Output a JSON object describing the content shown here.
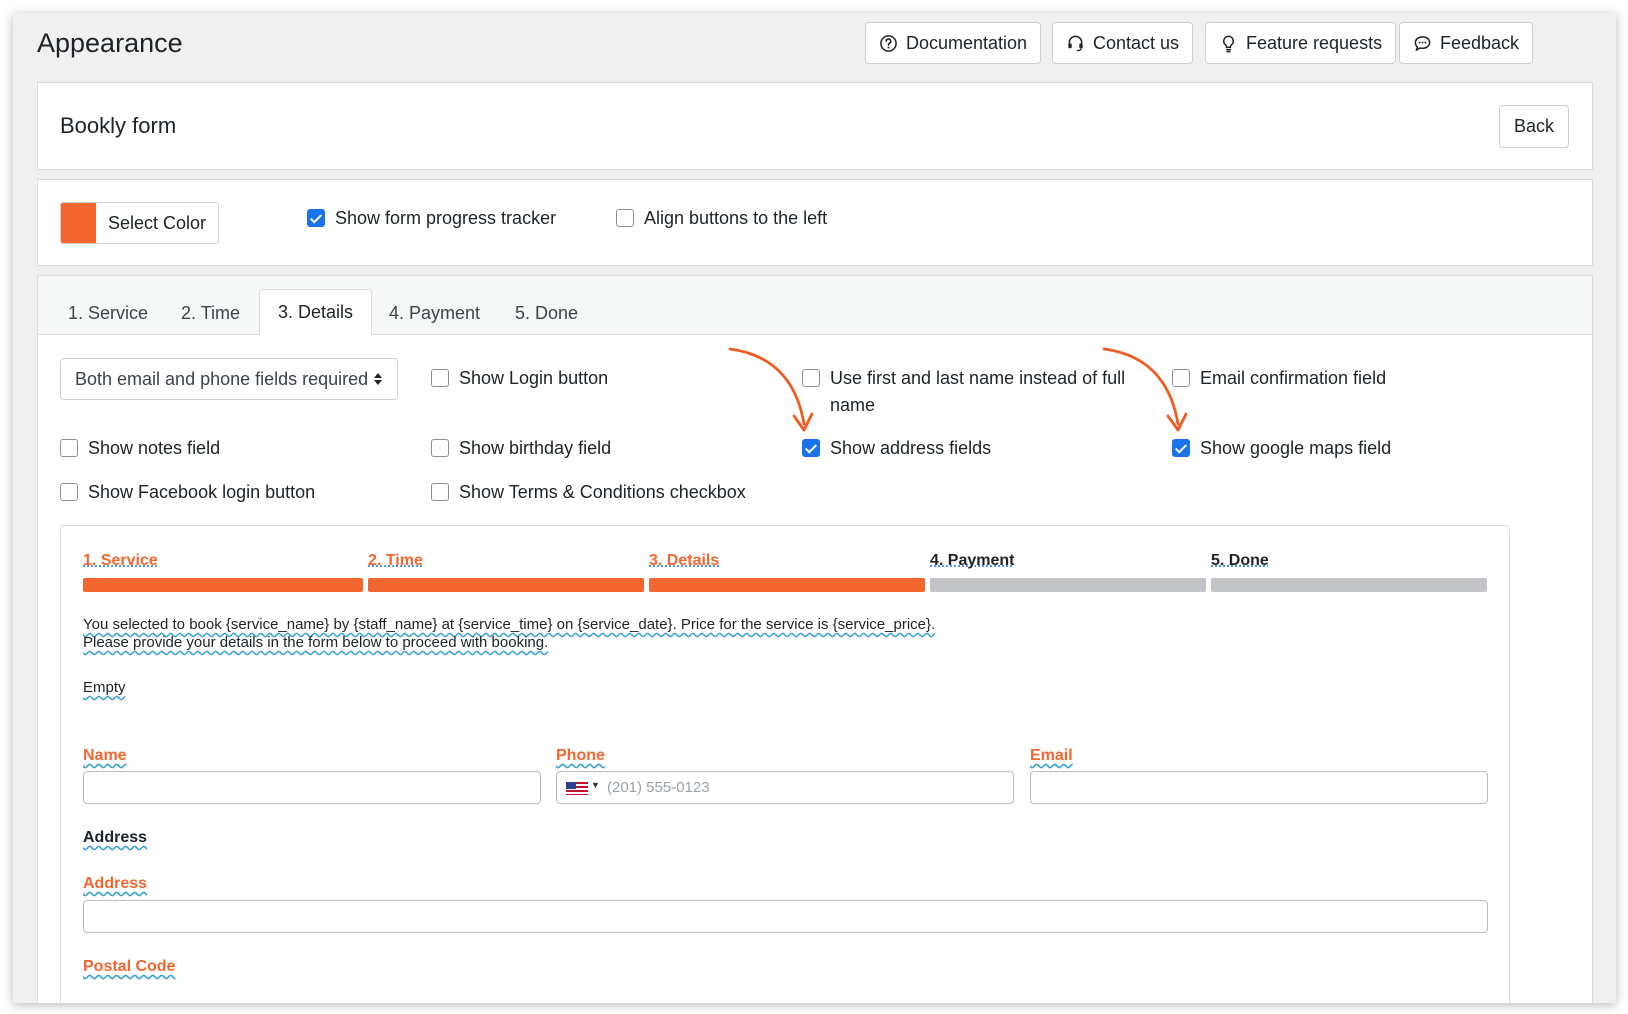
{
  "header": {
    "title": "Appearance",
    "buttons": {
      "documentation": "Documentation",
      "contact": "Contact us",
      "feature_requests": "Feature requests",
      "feedback": "Feedback"
    }
  },
  "form_card": {
    "title": "Bookly form",
    "back_label": "Back"
  },
  "settings": {
    "select_color": "Select Color",
    "accent_color": "#f4662f",
    "show_progress_tracker": {
      "label": "Show form progress tracker",
      "checked": true
    },
    "align_buttons_left": {
      "label": "Align buttons to the left",
      "checked": false
    }
  },
  "tabs": [
    {
      "label": "1. Service",
      "active": false
    },
    {
      "label": "2. Time",
      "active": false
    },
    {
      "label": "3. Details",
      "active": true
    },
    {
      "label": "4. Payment",
      "active": false
    },
    {
      "label": "5. Done",
      "active": false
    }
  ],
  "details_options": {
    "required_select": "Both email and phone fields required",
    "show_login": {
      "label": "Show Login button",
      "checked": false
    },
    "first_last_name": {
      "label": "Use first and last name instead of full name",
      "checked": false
    },
    "email_confirmation": {
      "label": "Email confirmation field",
      "checked": false
    },
    "show_notes": {
      "label": "Show notes field",
      "checked": false
    },
    "show_birthday": {
      "label": "Show birthday field",
      "checked": false
    },
    "show_address": {
      "label": "Show address fields",
      "checked": true
    },
    "show_google_maps": {
      "label": "Show google maps field",
      "checked": true
    },
    "show_facebook": {
      "label": "Show Facebook login button",
      "checked": false
    },
    "show_terms": {
      "label": "Show Terms & Conditions checkbox",
      "checked": false
    }
  },
  "preview": {
    "steps": [
      {
        "label": "1. Service",
        "done": true
      },
      {
        "label": "2. Time",
        "done": true
      },
      {
        "label": "3. Details",
        "done": true
      },
      {
        "label": "4. Payment",
        "done": false
      },
      {
        "label": "5. Done",
        "done": false
      }
    ],
    "info_line1": "You selected to book {service_name} by {staff_name} at {service_time} on {service_date}. Price for the service is {service_price}.",
    "info_line2": "Please provide your details in the form below to proceed with booking.",
    "empty_text": "Empty",
    "name_label": "Name",
    "phone_label": "Phone",
    "phone_placeholder": "(201) 555-0123",
    "email_label": "Email",
    "address_heading": "Address",
    "address_label": "Address",
    "postal_label": "Postal Code"
  }
}
